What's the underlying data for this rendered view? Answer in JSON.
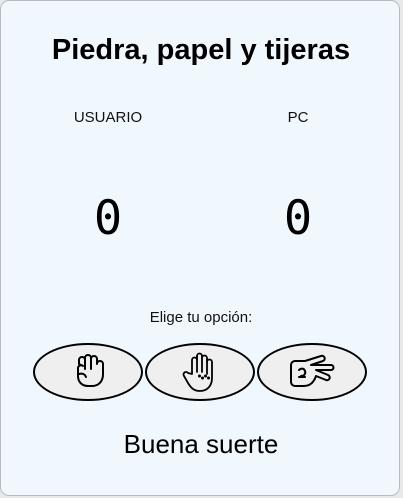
{
  "game": {
    "title": "Piedra, papel y tijeras"
  },
  "scoreboard": {
    "user_label": "USUARIO",
    "pc_label": "PC",
    "user_score": "0",
    "pc_score": "0"
  },
  "choices": {
    "prompt": "Elige tu opción:",
    "options": [
      {
        "name": "Piedra",
        "icon": "fist-icon"
      },
      {
        "name": "Papel",
        "icon": "open-hand-icon"
      },
      {
        "name": "Tijeras",
        "icon": "scissors-hand-icon"
      }
    ]
  },
  "status": {
    "message": "Buena suerte"
  }
}
